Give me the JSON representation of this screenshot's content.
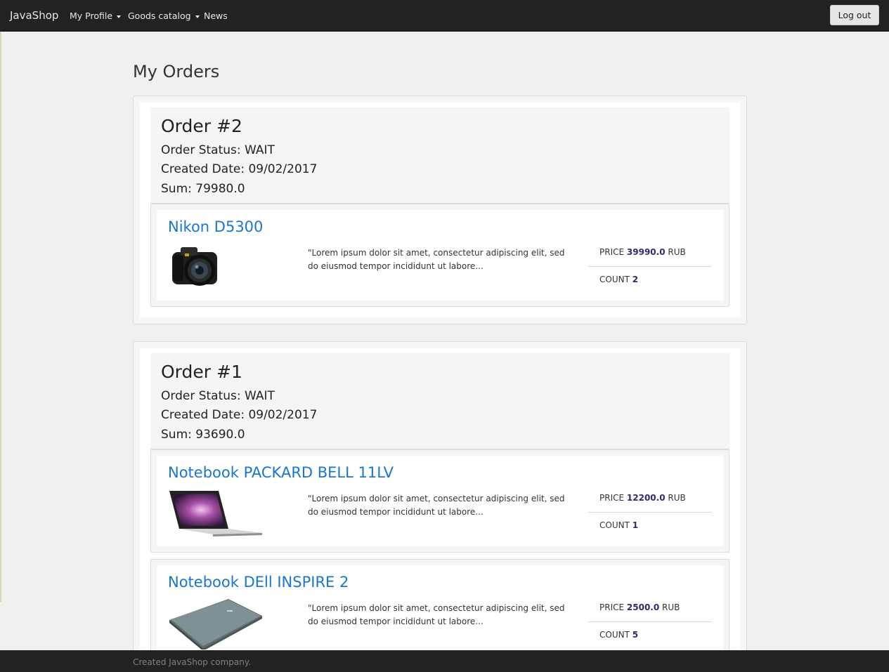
{
  "navbar": {
    "brand": "JavaShop",
    "items": [
      {
        "label": "My Profile",
        "dropdown": true
      },
      {
        "label": "Goods catalog",
        "dropdown": true
      },
      {
        "label": "News",
        "dropdown": false
      }
    ],
    "logout_label": "Log out"
  },
  "page": {
    "title": "My Orders"
  },
  "orders": [
    {
      "title": "Order #2",
      "status": "Order Status: WAIT",
      "created": "Created Date: 09/02/2017",
      "sum": "Sum: 79980.0",
      "products": [
        {
          "name": "Nikon D5300",
          "image": "camera",
          "description": "\"Lorem ipsum dolor sit amet, consectetur adipiscing elit, sed do eiusmod tempor incididunt ut labore...",
          "price_label": "PRICE",
          "price": "39990.0",
          "currency": "RUB",
          "count_label": "COUNT",
          "count": "2"
        }
      ]
    },
    {
      "title": "Order #1",
      "status": "Order Status: WAIT",
      "created": "Created Date: 09/02/2017",
      "sum": "Sum: 93690.0",
      "products": [
        {
          "name": "Notebook PACKARD BELL 11LV",
          "image": "laptop-open",
          "description": "\"Lorem ipsum dolor sit amet, consectetur adipiscing elit, sed do eiusmod tempor incididunt ut labore...",
          "price_label": "PRICE",
          "price": "12200.0",
          "currency": "RUB",
          "count_label": "COUNT",
          "count": "1"
        },
        {
          "name": "Notebook DEll INSPIRE 2",
          "image": "laptop-closed",
          "description": "\"Lorem ipsum dolor sit amet, consectetur adipiscing elit, sed do eiusmod tempor incididunt ut labore...",
          "price_label": "PRICE",
          "price": "2500.0",
          "currency": "RUB",
          "count_label": "COUNT",
          "count": "5"
        }
      ]
    }
  ],
  "footer": {
    "text": "Created JavaShop company."
  },
  "colors": {
    "navbar": "#222222",
    "page_background": "#f0f0f0",
    "link": "#1976d2",
    "number": "#2e2a6e"
  }
}
